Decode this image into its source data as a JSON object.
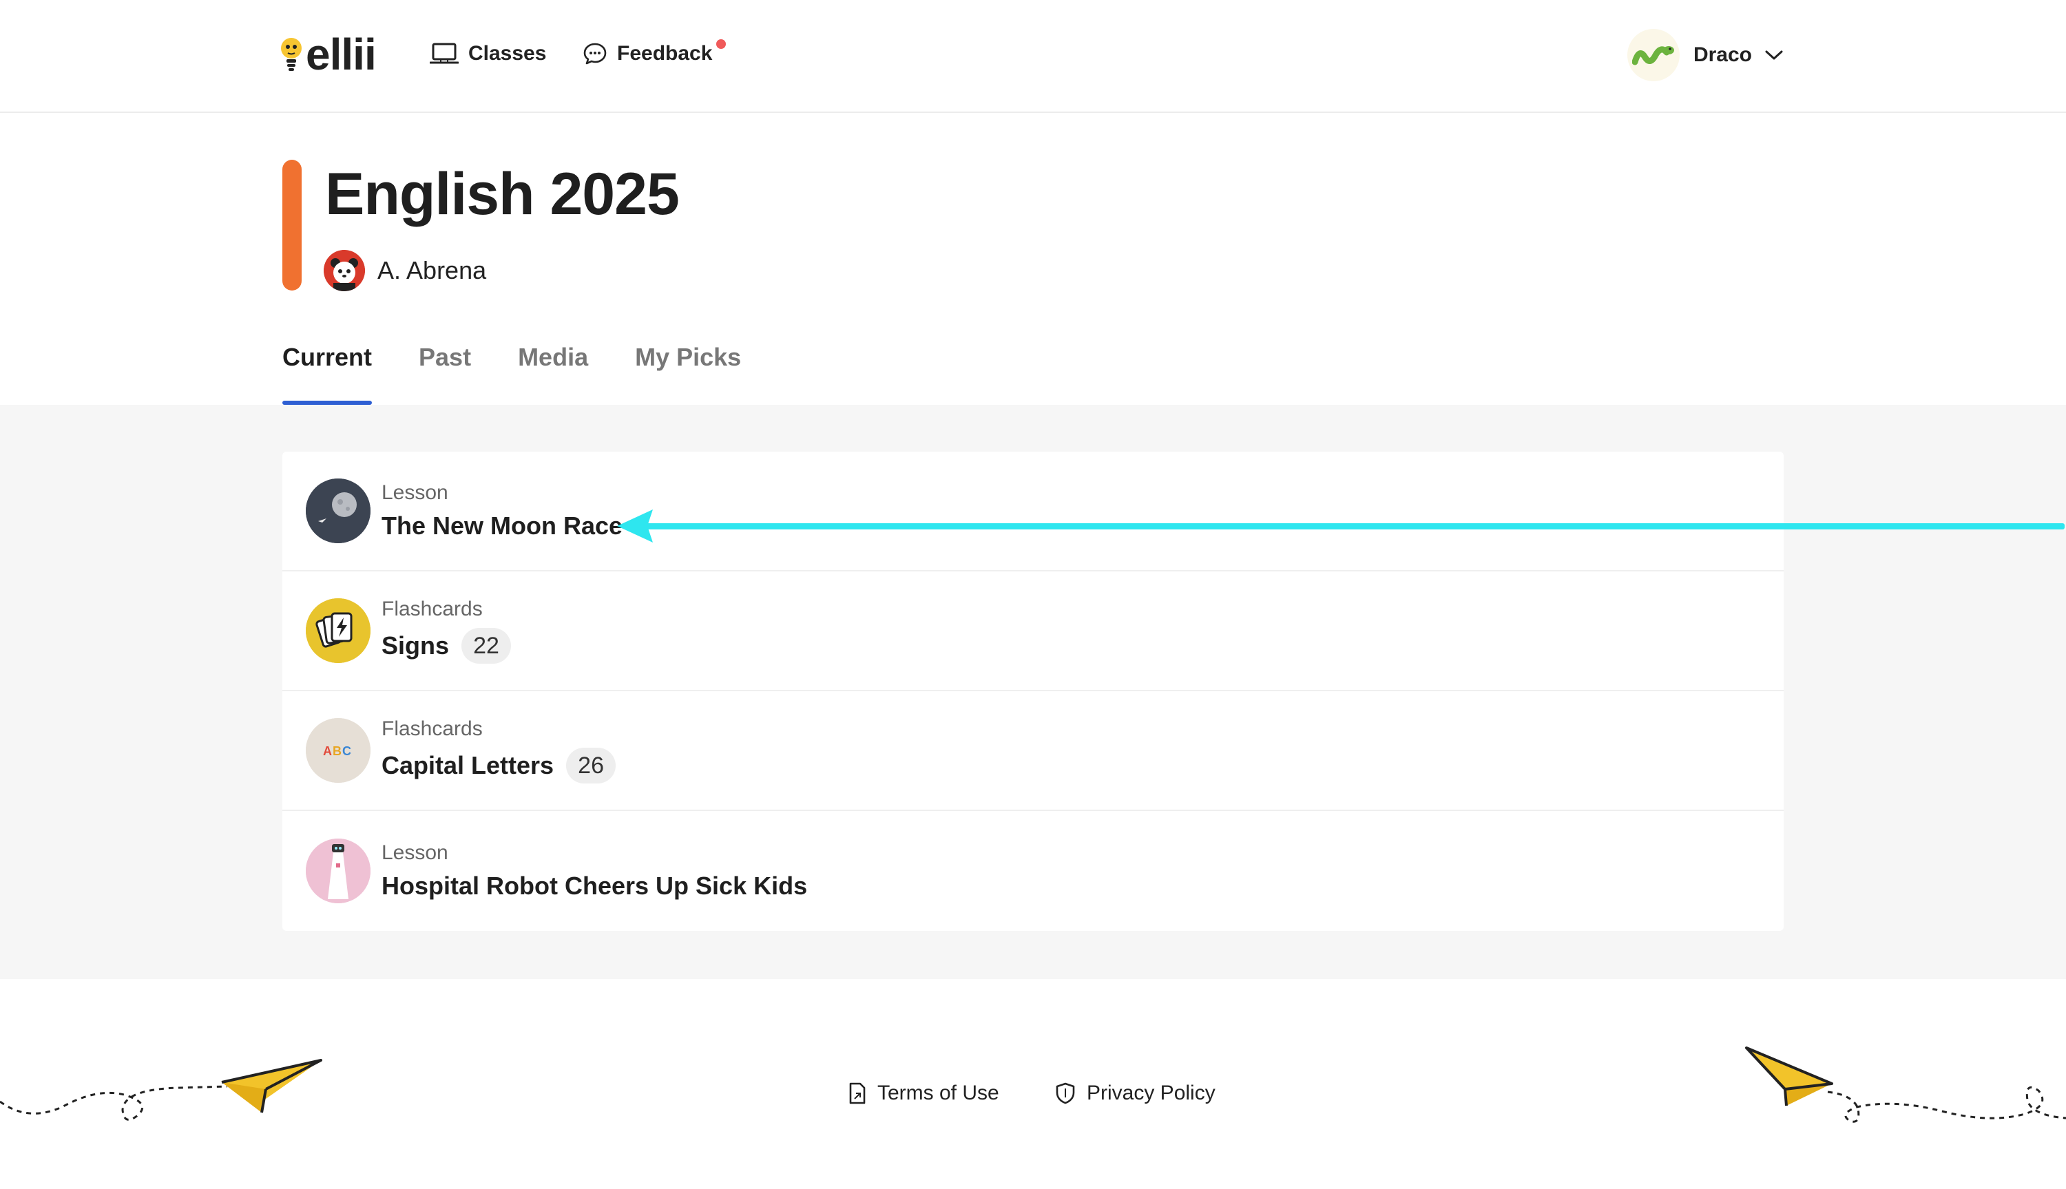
{
  "header": {
    "logo_text": "ellii",
    "nav": [
      {
        "label": "Classes",
        "icon": "laptop-icon"
      },
      {
        "label": "Feedback",
        "icon": "chat-bubble-icon",
        "notification": true
      }
    ],
    "user": {
      "name": "Draco",
      "avatar": "snake-avatar"
    }
  },
  "class": {
    "title": "English 2025",
    "accent_color": "#f07130",
    "teacher": {
      "name": "A. Abrena",
      "avatar": "panda-avatar"
    }
  },
  "tabs": [
    {
      "label": "Current",
      "active": true
    },
    {
      "label": "Past",
      "active": false
    },
    {
      "label": "Media",
      "active": false
    },
    {
      "label": "My Picks",
      "active": false
    }
  ],
  "items": [
    {
      "type": "Lesson",
      "title": "The New Moon Race",
      "thumb": "moon-thumbnail"
    },
    {
      "type": "Flashcards",
      "title": "Signs",
      "count": "22",
      "thumb": "flashcards-lightning-thumbnail"
    },
    {
      "type": "Flashcards",
      "title": "Capital Letters",
      "count": "26",
      "thumb": "abc-thumbnail"
    },
    {
      "type": "Lesson",
      "title": "Hospital Robot Cheers Up Sick Kids",
      "thumb": "robot-thumbnail"
    }
  ],
  "footer": {
    "links": [
      {
        "label": "Terms of Use",
        "icon": "document-icon"
      },
      {
        "label": "Privacy Policy",
        "icon": "shield-icon"
      }
    ]
  },
  "colors": {
    "tab_underline": "#2e5fd3",
    "annotation_arrow": "#2ee6ef",
    "content_background": "#f6f6f6"
  }
}
